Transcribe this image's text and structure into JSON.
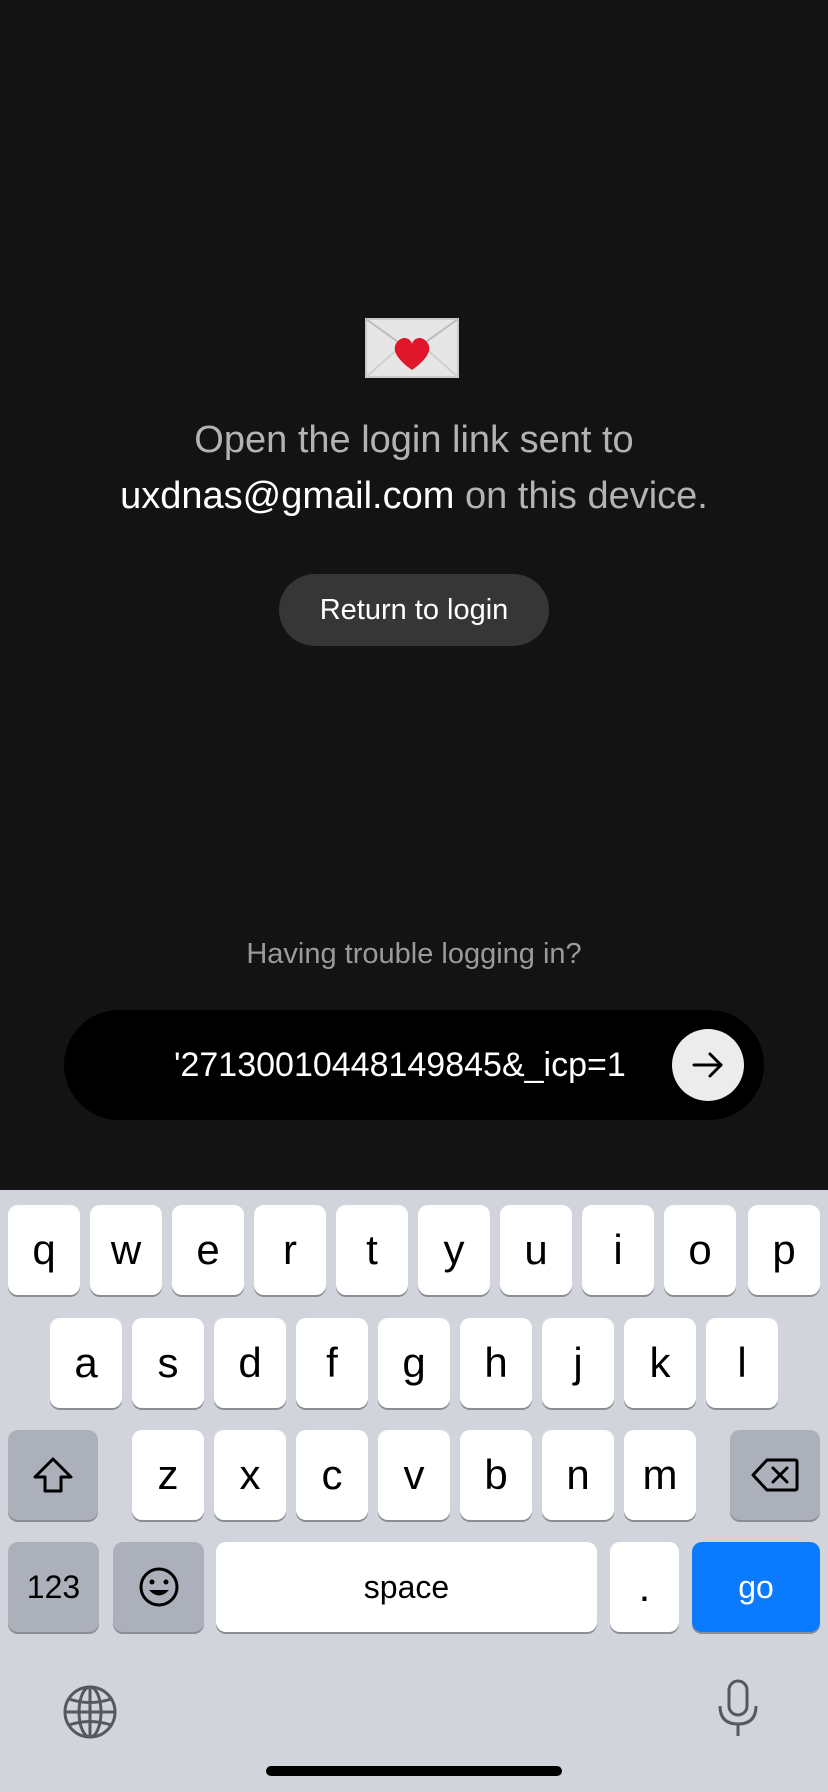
{
  "message": {
    "line1": "Open the login link sent to",
    "email": "uxdnas@gmail.com",
    "line2_suffix": " on this device."
  },
  "return_button": "Return to login",
  "trouble_text": "Having trouble logging in?",
  "url_bar": {
    "value": "'27130010448149845&_icp=1"
  },
  "keyboard": {
    "row1": [
      "q",
      "w",
      "e",
      "r",
      "t",
      "y",
      "u",
      "i",
      "o",
      "p"
    ],
    "row2": [
      "a",
      "s",
      "d",
      "f",
      "g",
      "h",
      "j",
      "k",
      "l"
    ],
    "row3": [
      "z",
      "x",
      "c",
      "v",
      "b",
      "n",
      "m"
    ],
    "numbers_key": "123",
    "space_key": "space",
    "period_key": ".",
    "go_key": "go"
  },
  "colors": {
    "background": "#131313",
    "go_key": "#0a7aff",
    "keyboard_bg": "#d1d4da"
  },
  "icons": [
    "envelope-heart-icon",
    "arrow-right-icon",
    "shift-icon",
    "delete-icon",
    "emoji-icon",
    "globe-icon",
    "microphone-icon"
  ]
}
